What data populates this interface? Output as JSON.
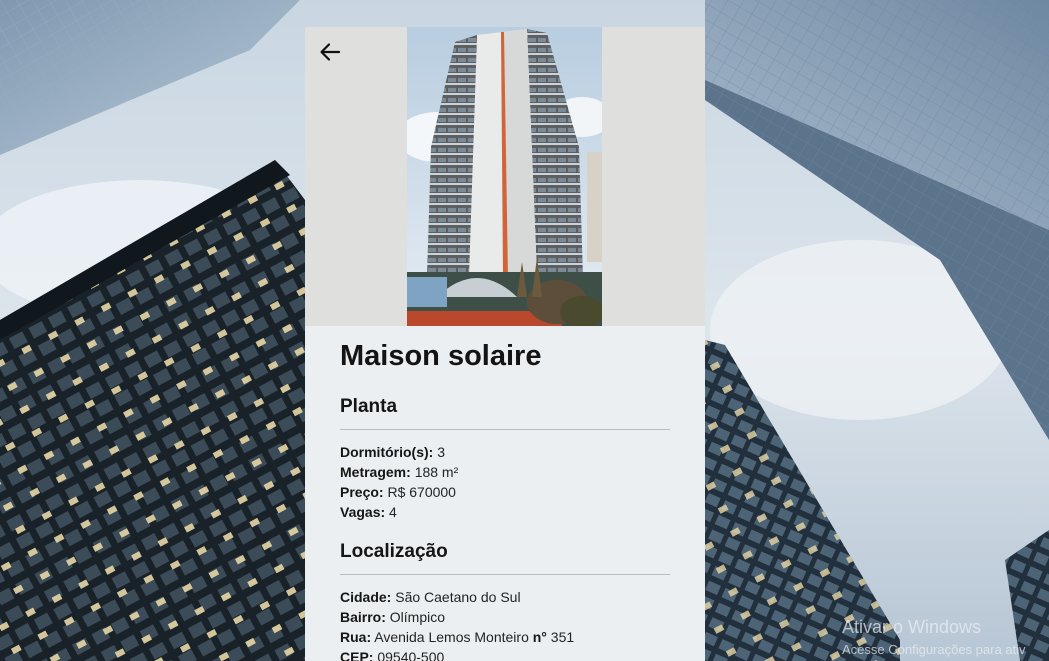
{
  "property": {
    "title": "Maison solaire",
    "planta": {
      "heading": "Planta",
      "bedrooms_label": "Dormitório(s):",
      "bedrooms_value": "3",
      "area_label": "Metragem:",
      "area_value": "188 m²",
      "price_label": "Preço:",
      "price_value": "R$ 670000",
      "parking_label": "Vagas:",
      "parking_value": "4"
    },
    "localizacao": {
      "heading": "Localização",
      "city_label": "Cidade:",
      "city_value": "São Caetano do Sul",
      "district_label": "Bairro:",
      "district_value": "Olímpico",
      "street_label": "Rua:",
      "street_value": "Avenida Lemos Monteiro",
      "number_label": "n°",
      "number_value": "351",
      "cep_label": "CEP:",
      "cep_value": "09540-500"
    }
  },
  "icons": {
    "back": "arrow-left-icon"
  },
  "watermark": {
    "line1": "Ativar o Windows",
    "line2": "Acesse Configurações para ativ"
  },
  "colors": {
    "card_background": "#ebeff1",
    "hero_background": "#dfdfdd",
    "accent_stripe": "#d2643a"
  }
}
